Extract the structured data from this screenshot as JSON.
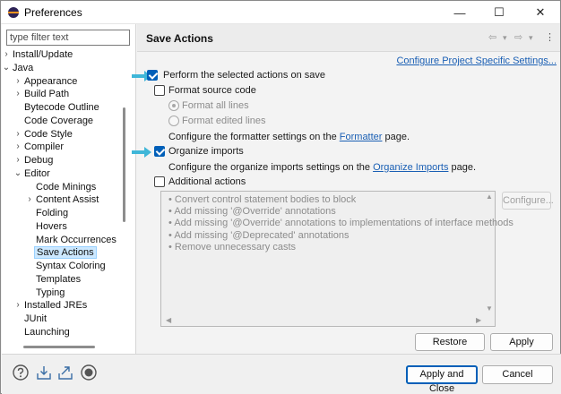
{
  "window": {
    "title": "Preferences",
    "minimize": "—",
    "maximize": "☐",
    "close": "✕"
  },
  "filter": {
    "placeholder": "type filter text"
  },
  "tree": [
    {
      "label": "Install/Update",
      "twisty": "›"
    },
    {
      "label": "Java",
      "twisty": "⌄"
    },
    {
      "label": "Appearance",
      "twisty": "›"
    },
    {
      "label": "Build Path",
      "twisty": "›"
    },
    {
      "label": "Bytecode Outline",
      "twisty": ""
    },
    {
      "label": "Code Coverage",
      "twisty": ""
    },
    {
      "label": "Code Style",
      "twisty": "›"
    },
    {
      "label": "Compiler",
      "twisty": "›"
    },
    {
      "label": "Debug",
      "twisty": "›"
    },
    {
      "label": "Editor",
      "twisty": "⌄"
    },
    {
      "label": "Code Minings",
      "twisty": ""
    },
    {
      "label": "Content Assist",
      "twisty": "›"
    },
    {
      "label": "Folding",
      "twisty": ""
    },
    {
      "label": "Hovers",
      "twisty": ""
    },
    {
      "label": "Mark Occurrences",
      "twisty": ""
    },
    {
      "label": "Save Actions",
      "twisty": "",
      "selected": true
    },
    {
      "label": "Syntax Coloring",
      "twisty": ""
    },
    {
      "label": "Templates",
      "twisty": ""
    },
    {
      "label": "Typing",
      "twisty": ""
    },
    {
      "label": "Installed JREs",
      "twisty": "›"
    },
    {
      "label": "JUnit",
      "twisty": ""
    },
    {
      "label": "Launching",
      "twisty": ""
    }
  ],
  "page": {
    "title": "Save Actions",
    "nav_back": "⇦",
    "nav_forward": "⇨",
    "nav_dropdown": "▾",
    "nav_menu": "⋮",
    "project_link": "Configure Project Specific Settings...",
    "perform_label": "Perform the selected actions on save",
    "format_label": "Format source code",
    "format_all": "Format all lines",
    "format_edited": "Format edited lines",
    "formatter_text_pre": "Configure the formatter settings on the ",
    "formatter_link": "Formatter",
    "formatter_text_post": " page.",
    "organize_label": "Organize imports",
    "organize_text_pre": "Configure the organize imports settings on the ",
    "organize_link": "Organize Imports",
    "organize_text_post": " page.",
    "additional_label": "Additional actions",
    "additional_items": [
      "Convert control statement bodies to block",
      "Add missing '@Override' annotations",
      "Add missing '@Override' annotations to implementations of interface methods",
      "Add missing '@Deprecated' annotations",
      "Remove unnecessary casts"
    ],
    "configure_button": "Configure...",
    "restore_defaults": "Restore Defaults",
    "apply": "Apply"
  },
  "bottom": {
    "apply_and_close": "Apply and Close",
    "cancel": "Cancel"
  },
  "colors": {
    "accent": "#005fb8",
    "link": "#1a5fb4",
    "callout_arrow": "#3fb6d8",
    "selection": "#cce8ff"
  }
}
